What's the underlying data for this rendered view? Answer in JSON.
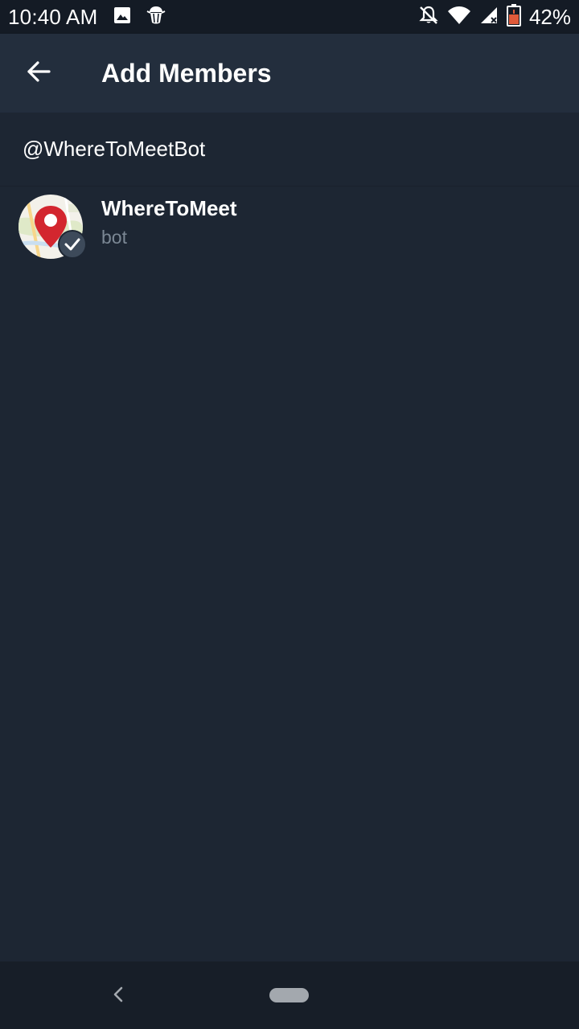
{
  "status_bar": {
    "time": "10:40 AM",
    "battery_percent": "42%",
    "icons": [
      "image-icon",
      "bug-icon",
      "notifications-off-icon",
      "wifi-icon",
      "cell-signal-icon",
      "battery-icon"
    ]
  },
  "app_bar": {
    "title": "Add Members",
    "back_icon": "arrow-left-icon"
  },
  "search": {
    "value": "@WhereToMeetBot"
  },
  "members": [
    {
      "name": "WhereToMeet",
      "status": "bot",
      "selected": true,
      "avatar_icon": "map-pin-icon"
    }
  ],
  "colors": {
    "background": "#1d2633",
    "app_bar": "#232e3d",
    "status_bar": "#141b25",
    "secondary_text": "#7b8794",
    "pin_red": "#d3262f",
    "check_badge": "#3d4a5a"
  },
  "nav_bar": {
    "icons": [
      "back-chevron-icon",
      "home-pill-icon"
    ]
  }
}
